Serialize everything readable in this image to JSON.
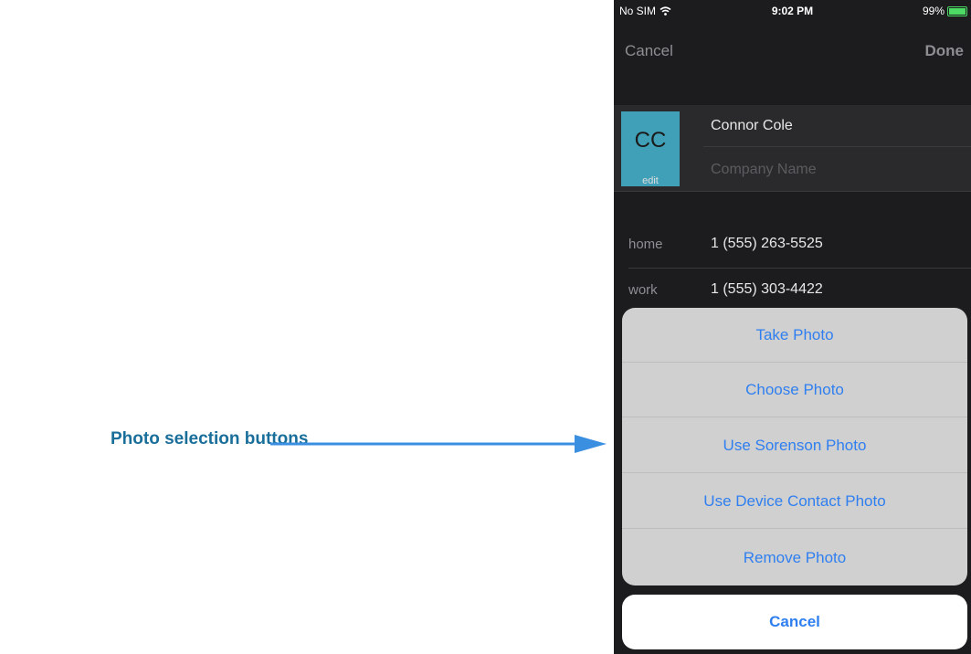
{
  "callout": {
    "label": "Photo selection buttons"
  },
  "status_bar": {
    "carrier": "No SIM",
    "time": "9:02 PM",
    "battery": "99%"
  },
  "nav": {
    "cancel_label": "Cancel",
    "done_label": "Done"
  },
  "contact": {
    "initials": "CC",
    "edit_label": "edit",
    "name": "Connor Cole",
    "company_placeholder": "Company Name"
  },
  "phones": [
    {
      "label": "home",
      "number": "1 (555) 263-5525"
    },
    {
      "label": "work",
      "number": "1 (555) 303-4422"
    }
  ],
  "action_sheet": {
    "buttons": [
      "Take Photo",
      "Choose Photo",
      "Use Sorenson Photo",
      "Use Device Contact Photo",
      "Remove Photo"
    ],
    "cancel_label": "Cancel"
  },
  "colors": {
    "callout_text": "#1a6f9a",
    "arrow": "#3b8fe0",
    "ios_blue": "#2f7ff0",
    "avatar_bg": "#40a0b8"
  }
}
